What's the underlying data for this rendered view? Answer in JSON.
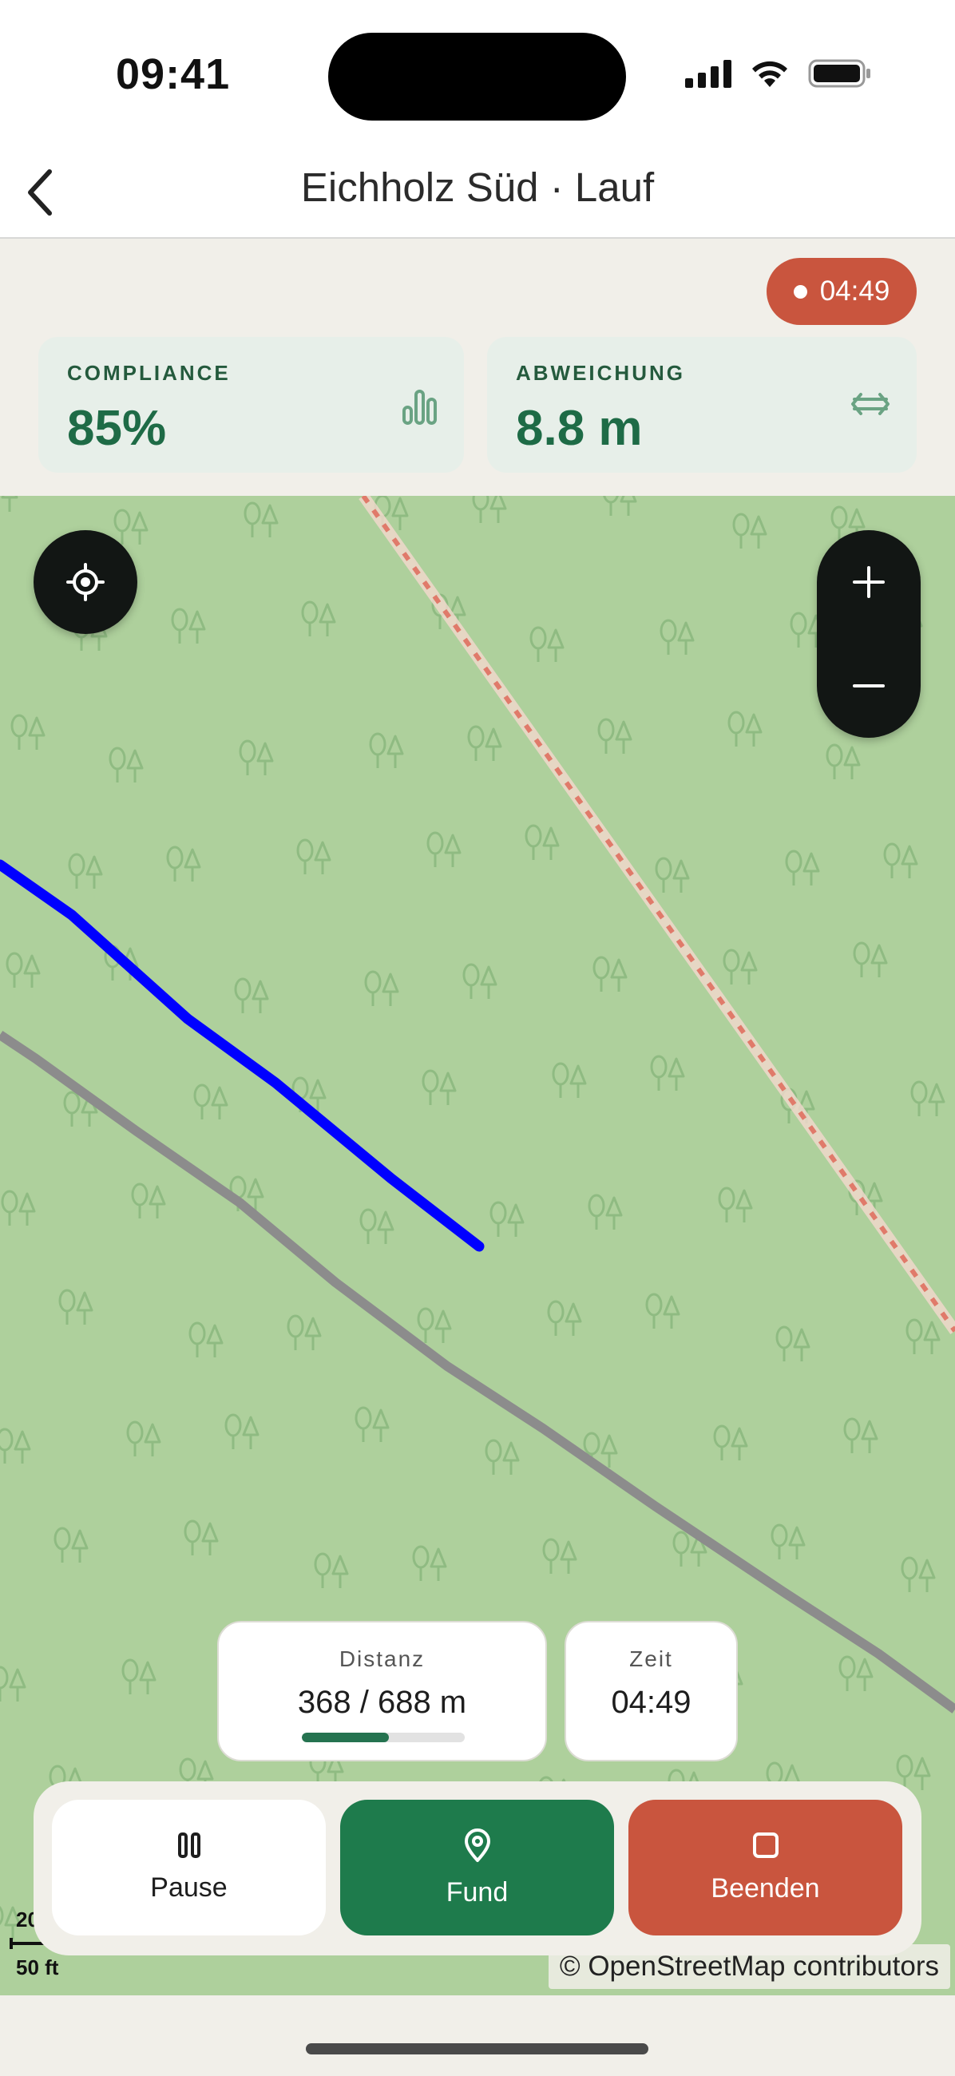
{
  "status_bar": {
    "time": "09:41"
  },
  "header": {
    "title": "Eichholz Süd · Lauf",
    "back_icon": "chevron-left-icon"
  },
  "recording": {
    "time": "04:49"
  },
  "stats": {
    "compliance": {
      "label": "COMPLIANCE",
      "value": "85%"
    },
    "deviation": {
      "label": "ABWEICHUNG",
      "value": "8.8 m"
    }
  },
  "map": {
    "distance": {
      "label": "Distanz",
      "value": "368 / 688 m",
      "progress": 0.535
    },
    "time": {
      "label": "Zeit",
      "value": "04:49"
    },
    "scale": {
      "top": "20",
      "bottom": "50 ft"
    },
    "attribution": "© OpenStreetMap contributors",
    "colors": {
      "forest": "#aed09c",
      "tree": "#8fbb82",
      "track": "#0000ff",
      "path": "#8c8c8c",
      "boundary": "#e88c7c"
    }
  },
  "actions": {
    "pause": "Pause",
    "find": "Fund",
    "stop": "Beenden"
  },
  "colors": {
    "accent_green": "#1e7b4c",
    "danger": "#c9553e",
    "dark": "#121614"
  }
}
